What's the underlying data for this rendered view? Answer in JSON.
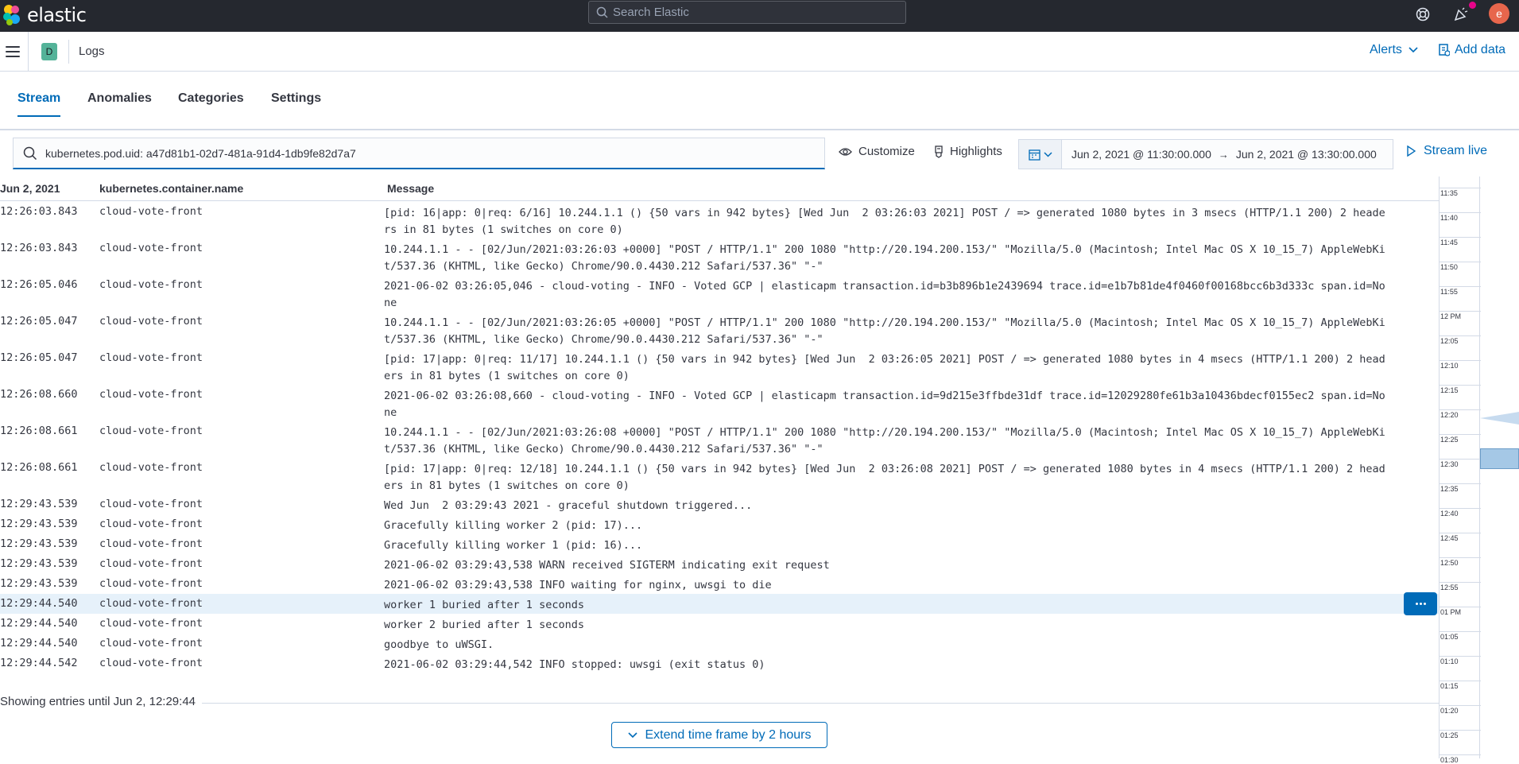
{
  "topbar": {
    "app_name": "elastic",
    "search_placeholder": "Search Elastic",
    "user_initial": "e",
    "colors": {
      "bg": "#25282f",
      "avatar": "#e7664c",
      "notif": "#e7048a"
    }
  },
  "breadcrumb": {
    "space_initial": "D",
    "current": "Logs",
    "alerts_label": "Alerts",
    "add_data_label": "Add data"
  },
  "tabs": [
    {
      "label": "Stream",
      "active": true
    },
    {
      "label": "Anomalies"
    },
    {
      "label": "Categories"
    },
    {
      "label": "Settings"
    }
  ],
  "filter": {
    "query": "kubernetes.pod.uid: a47d81b1-02d7-481a-91d4-1db9fe82d7a7",
    "customize_label": "Customize",
    "highlights_label": "Highlights",
    "start": "Jun 2, 2021 @ 11:30:00.000",
    "end": "Jun 2, 2021 @ 13:30:00.000",
    "stream_live_label": "Stream live"
  },
  "table": {
    "columns": [
      "Jun 2, 2021",
      "kubernetes.container.name",
      "Message"
    ],
    "rows": [
      {
        "ts": "12:26:03.843",
        "cn": "cloud-vote-front",
        "msg": "[pid: 16|app: 0|req: 6/16] 10.244.1.1 () {50 vars in 942 bytes} [Wed Jun  2 03:26:03 2021] POST / => generated 1080 bytes in 3 msecs (HTTP/1.1 200) 2 headers in 81 bytes (1 switches on core 0)"
      },
      {
        "ts": "12:26:03.843",
        "cn": "cloud-vote-front",
        "msg": "10.244.1.1 - - [02/Jun/2021:03:26:03 +0000] \"POST / HTTP/1.1\" 200 1080 \"http://20.194.200.153/\" \"Mozilla/5.0 (Macintosh; Intel Mac OS X 10_15_7) AppleWebKit/537.36 (KHTML, like Gecko) Chrome/90.0.4430.212 Safari/537.36\" \"-\""
      },
      {
        "ts": "12:26:05.046",
        "cn": "cloud-vote-front",
        "msg": "2021-06-02 03:26:05,046 - cloud-voting - INFO - Voted GCP | elasticapm transaction.id=b3b896b1e2439694 trace.id=e1b7b81de4f0460f00168bcc6b3d333c span.id=None"
      },
      {
        "ts": "12:26:05.047",
        "cn": "cloud-vote-front",
        "msg": "10.244.1.1 - - [02/Jun/2021:03:26:05 +0000] \"POST / HTTP/1.1\" 200 1080 \"http://20.194.200.153/\" \"Mozilla/5.0 (Macintosh; Intel Mac OS X 10_15_7) AppleWebKit/537.36 (KHTML, like Gecko) Chrome/90.0.4430.212 Safari/537.36\" \"-\""
      },
      {
        "ts": "12:26:05.047",
        "cn": "cloud-vote-front",
        "msg": "[pid: 17|app: 0|req: 11/17] 10.244.1.1 () {50 vars in 942 bytes} [Wed Jun  2 03:26:05 2021] POST / => generated 1080 bytes in 4 msecs (HTTP/1.1 200) 2 headers in 81 bytes (1 switches on core 0)"
      },
      {
        "ts": "12:26:08.660",
        "cn": "cloud-vote-front",
        "msg": "2021-06-02 03:26:08,660 - cloud-voting - INFO - Voted GCP | elasticapm transaction.id=9d215e3ffbde31df trace.id=12029280fe61b3a10436bdecf0155ec2 span.id=None"
      },
      {
        "ts": "12:26:08.661",
        "cn": "cloud-vote-front",
        "msg": "10.244.1.1 - - [02/Jun/2021:03:26:08 +0000] \"POST / HTTP/1.1\" 200 1080 \"http://20.194.200.153/\" \"Mozilla/5.0 (Macintosh; Intel Mac OS X 10_15_7) AppleWebKit/537.36 (KHTML, like Gecko) Chrome/90.0.4430.212 Safari/537.36\" \"-\""
      },
      {
        "ts": "12:26:08.661",
        "cn": "cloud-vote-front",
        "msg": "[pid: 17|app: 0|req: 12/18] 10.244.1.1 () {50 vars in 942 bytes} [Wed Jun  2 03:26:08 2021] POST / => generated 1080 bytes in 4 msecs (HTTP/1.1 200) 2 headers in 81 bytes (1 switches on core 0)"
      },
      {
        "ts": "12:29:43.539",
        "cn": "cloud-vote-front",
        "msg": "Wed Jun  2 03:29:43 2021 - graceful shutdown triggered..."
      },
      {
        "ts": "12:29:43.539",
        "cn": "cloud-vote-front",
        "msg": "Gracefully killing worker 2 (pid: 17)..."
      },
      {
        "ts": "12:29:43.539",
        "cn": "cloud-vote-front",
        "msg": "Gracefully killing worker 1 (pid: 16)..."
      },
      {
        "ts": "12:29:43.539",
        "cn": "cloud-vote-front",
        "msg": "2021-06-02 03:29:43,538 WARN received SIGTERM indicating exit request"
      },
      {
        "ts": "12:29:43.539",
        "cn": "cloud-vote-front",
        "msg": "2021-06-02 03:29:43,538 INFO waiting for nginx, uwsgi to die"
      },
      {
        "ts": "12:29:44.540",
        "cn": "cloud-vote-front",
        "msg": "worker 1 buried after 1 seconds",
        "highlighted": true
      },
      {
        "ts": "12:29:44.540",
        "cn": "cloud-vote-front",
        "msg": "worker 2 buried after 1 seconds"
      },
      {
        "ts": "12:29:44.540",
        "cn": "cloud-vote-front",
        "msg": "goodbye to uWSGI."
      },
      {
        "ts": "12:29:44.542",
        "cn": "cloud-vote-front",
        "msg": "2021-06-02 03:29:44,542 INFO stopped: uwsgi (exit status 0)"
      }
    ]
  },
  "footer": {
    "showing": "Showing entries until Jun 2, 12:29:44",
    "extend_label": "Extend time frame by 2 hours"
  },
  "minimap": {
    "ticks": [
      "11:35",
      "11:40",
      "11:45",
      "11:50",
      "11:55",
      "12 PM",
      "12:05",
      "12:10",
      "12:15",
      "12:20",
      "12:25",
      "12:30",
      "12:35",
      "12:40",
      "12:45",
      "12:50",
      "12:55",
      "01 PM",
      "01:05",
      "01:10",
      "01:15",
      "01:20",
      "01:25",
      "01:30"
    ]
  }
}
